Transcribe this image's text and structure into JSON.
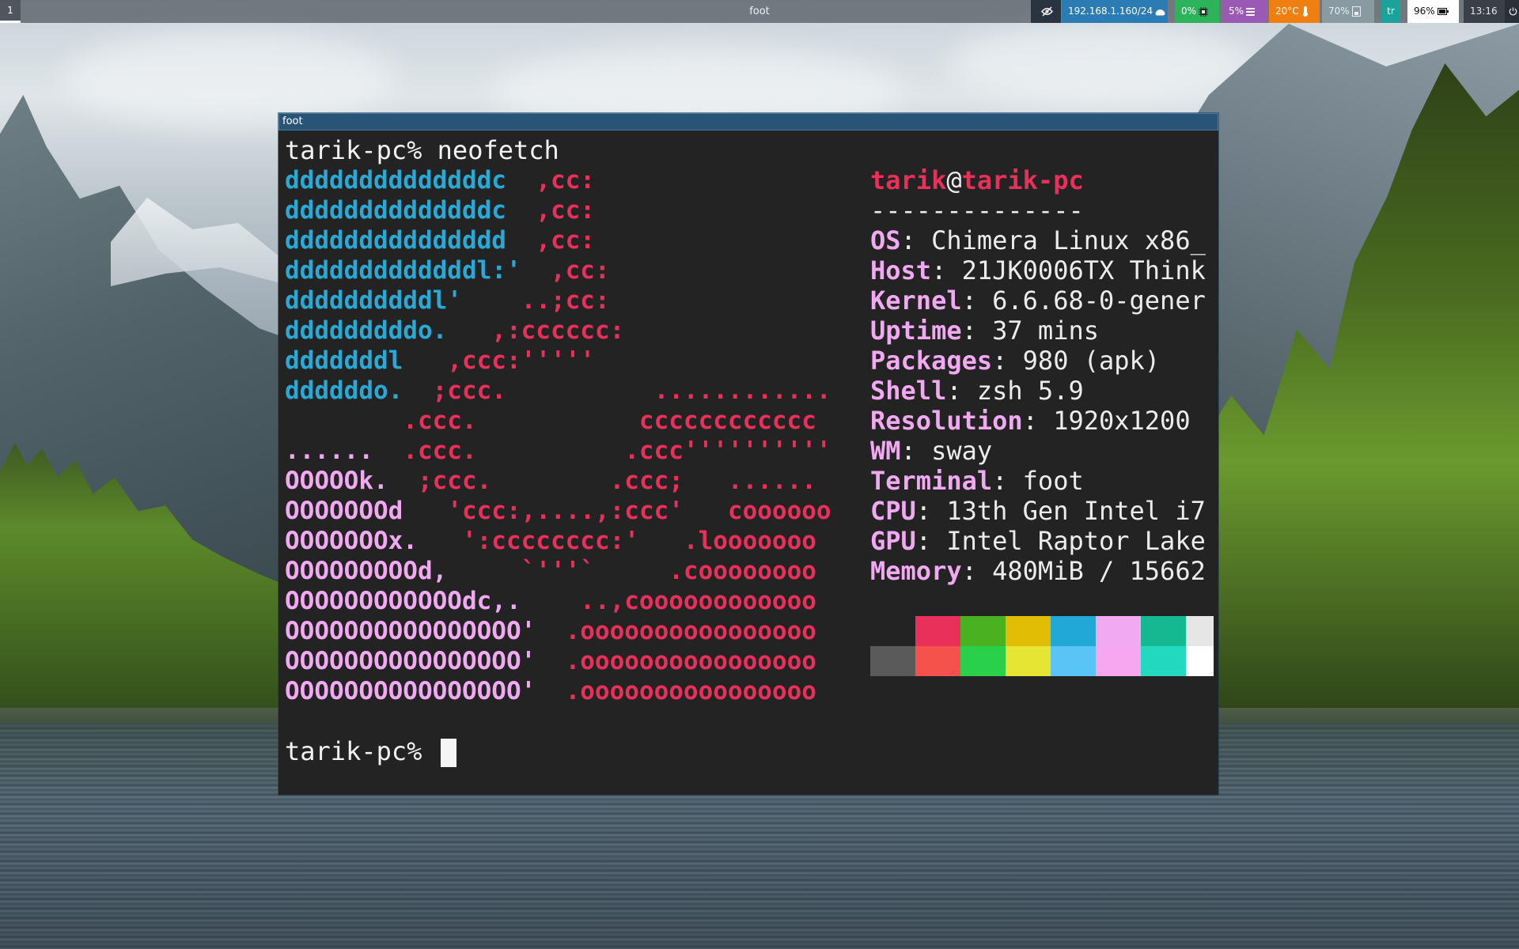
{
  "topbar": {
    "workspace": "1",
    "window_title": "foot",
    "network": "192.168.1.160/24",
    "cpu": "0%",
    "memory": "5%",
    "temperature": "20°C",
    "backlight": "70%",
    "keyboard_layout": "tr",
    "battery": "96%",
    "clock": "13:16",
    "colors": {
      "privacy_bg": "#2a3440",
      "network_bg": "#2b7bb4",
      "cpu_bg": "#2db35a",
      "memory_bg": "#9b59b6",
      "temperature_bg": "#f07f12",
      "backlight_bg": "#8a9aa2",
      "keyboard_bg": "#1aa39a",
      "battery_bg": "#ffffff",
      "clock_bg": "#3a4048"
    },
    "icons": [
      "eye-off-icon",
      "network-icon",
      "cpu-icon",
      "memory-icon",
      "thermometer-icon",
      "backlight-icon",
      "battery-icon",
      "power-icon"
    ]
  },
  "window": {
    "title": "foot"
  },
  "terminal": {
    "command_line": "tarik-pc% neofetch",
    "prompt": "tarik-pc% ",
    "logo": [
      [
        {
          "t": "ddddddddddddddc  ",
          "c": "c-cyan"
        },
        {
          "t": ",cc:",
          "c": "c-red"
        }
      ],
      [
        {
          "t": "ddddddddddddddc  ",
          "c": "c-cyan"
        },
        {
          "t": ",cc:",
          "c": "c-red"
        }
      ],
      [
        {
          "t": "ddddddddddddddd  ",
          "c": "c-cyan"
        },
        {
          "t": ",cc:",
          "c": "c-red"
        }
      ],
      [
        {
          "t": "dddddddddddddl:'  ",
          "c": "c-cyan"
        },
        {
          "t": ",cc:",
          "c": "c-red"
        }
      ],
      [
        {
          "t": "ddddddddddl'    ",
          "c": "c-cyan"
        },
        {
          "t": "..;cc:",
          "c": "c-red"
        }
      ],
      [
        {
          "t": "dddddddddo.   ",
          "c": "c-cyan"
        },
        {
          "t": ",:cccccc:",
          "c": "c-red"
        }
      ],
      [
        {
          "t": "dddddddl   ",
          "c": "c-cyan"
        },
        {
          "t": ",ccc:'''''",
          "c": "c-red"
        }
      ],
      [
        {
          "t": "ddddddo.  ",
          "c": "c-cyan"
        },
        {
          "t": ";ccc.          ............",
          "c": "c-red"
        }
      ],
      [
        {
          "t": "        .ccc.           cccccccccccc",
          "c": "c-red"
        }
      ],
      [
        {
          "t": "......  ",
          "c": "c-pink"
        },
        {
          "t": ".ccc.          .ccc''''''''''",
          "c": "c-red"
        }
      ],
      [
        {
          "t": "OOOOOk.  ",
          "c": "c-pink"
        },
        {
          "t": ";ccc.        .ccc;   ......",
          "c": "c-red"
        }
      ],
      [
        {
          "t": "OOOOOOOd   ",
          "c": "c-pink"
        },
        {
          "t": "'ccc:,....,:ccc'   coooooo",
          "c": "c-red"
        }
      ],
      [
        {
          "t": "OOOOOOOx.   ",
          "c": "c-pink"
        },
        {
          "t": "':cccccccc:'   .looooooo",
          "c": "c-red"
        }
      ],
      [
        {
          "t": "OOOOOOOOOd,     ",
          "c": "c-pink"
        },
        {
          "t": "`'''`     .coooooooo",
          "c": "c-red"
        }
      ],
      [
        {
          "t": "OOOOOOOOOOOOdc,.    ",
          "c": "c-pink"
        },
        {
          "t": "..,coooooooooooo",
          "c": "c-red"
        }
      ],
      [
        {
          "t": "OOOOOOOOOOOOOOOO'  ",
          "c": "c-pink"
        },
        {
          "t": ".oooooooooooooooo",
          "c": "c-red"
        }
      ],
      [
        {
          "t": "OOOOOOOOOOOOOOOO'  ",
          "c": "c-pink"
        },
        {
          "t": ".oooooooooooooooo",
          "c": "c-red"
        }
      ],
      [
        {
          "t": "OOOOOOOOOOOOOOOO'  ",
          "c": "c-pink"
        },
        {
          "t": ".oooooooooooooooo",
          "c": "c-red"
        }
      ]
    ],
    "info": {
      "user": "tarik",
      "at": "@",
      "host": "tarik-pc",
      "separator": "--------------",
      "fields": [
        {
          "key": "OS",
          "value": ": Chimera Linux x86_"
        },
        {
          "key": "Host",
          "value": ": 21JK0006TX Think"
        },
        {
          "key": "Kernel",
          "value": ": 6.6.68-0-gener"
        },
        {
          "key": "Uptime",
          "value": ": 37 mins"
        },
        {
          "key": "Packages",
          "value": ": 980 (apk)"
        },
        {
          "key": "Shell",
          "value": ": zsh 5.9"
        },
        {
          "key": "Resolution",
          "value": ": 1920x1200"
        },
        {
          "key": "WM",
          "value": ": sway"
        },
        {
          "key": "Terminal",
          "value": ": foot"
        },
        {
          "key": "CPU",
          "value": ": 13th Gen Intel i7"
        },
        {
          "key": "GPU",
          "value": ": Intel Raptor Lake"
        },
        {
          "key": "Memory",
          "value": ": 480MiB / 15662"
        }
      ]
    },
    "palette_top": [
      "#232323",
      "#e8305b",
      "#4ab220",
      "#e2bd05",
      "#22a8d6",
      "#f1a9f1",
      "#16b892",
      "#e6e6e6"
    ],
    "palette_bottom": [
      "#5a5a5a",
      "#f5524e",
      "#2bd04a",
      "#e6e534",
      "#5bc4f6",
      "#f6a7ee",
      "#22d9c0",
      "#ffffff"
    ]
  }
}
